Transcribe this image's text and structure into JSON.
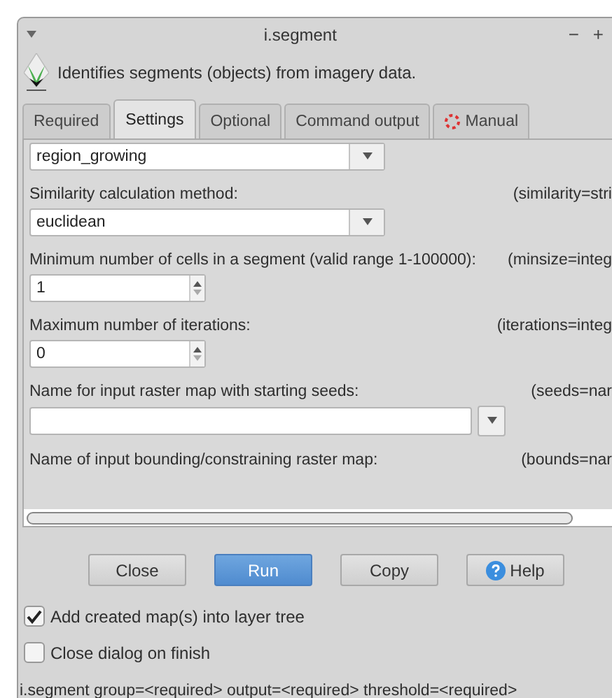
{
  "window": {
    "title": "i.segment",
    "controls": [
      "−",
      "+"
    ]
  },
  "description": "Identifies segments (objects) from imagery data.",
  "tabs": [
    {
      "label": "Required",
      "selected": false,
      "kind": "plain"
    },
    {
      "label": "Settings",
      "selected": true,
      "kind": "plain"
    },
    {
      "label": "Optional",
      "selected": false,
      "kind": "plain"
    },
    {
      "label": "Command output",
      "selected": false,
      "kind": "plain"
    },
    {
      "label": "Manual",
      "selected": false,
      "kind": "manual"
    }
  ],
  "parameters": [
    {
      "kind": "combo",
      "value": "region_growing"
    },
    {
      "kind": "combo",
      "label": "Similarity calculation method:",
      "hint": "(similarity=stri",
      "value": "euclidean"
    },
    {
      "kind": "spin",
      "label": "Minimum number of cells in a segment (valid range 1-100000):",
      "hint": "(minsize=integ",
      "value": "1"
    },
    {
      "kind": "spin",
      "label": "Maximum number of iterations:",
      "hint": "(iterations=integ",
      "value": "0"
    },
    {
      "kind": "wide-combo",
      "label": "Name for input raster map with starting seeds:",
      "hint": "(seeds=nar"
    },
    {
      "kind": "label",
      "label": "Name of input bounding/constraining raster map:",
      "hint": "(bounds=nar"
    }
  ],
  "buttons": [
    {
      "label": "Close",
      "kind": "default"
    },
    {
      "label": "Run",
      "kind": "primary"
    },
    {
      "label": "Copy",
      "kind": "default"
    },
    {
      "label": "Help",
      "kind": "help"
    }
  ],
  "checkboxes": [
    {
      "label": "Add created map(s) into layer tree",
      "checked": true
    },
    {
      "label": "Close dialog on finish",
      "checked": false
    }
  ],
  "command": "i.segment group=<required> output=<required> threshold=<required>"
}
